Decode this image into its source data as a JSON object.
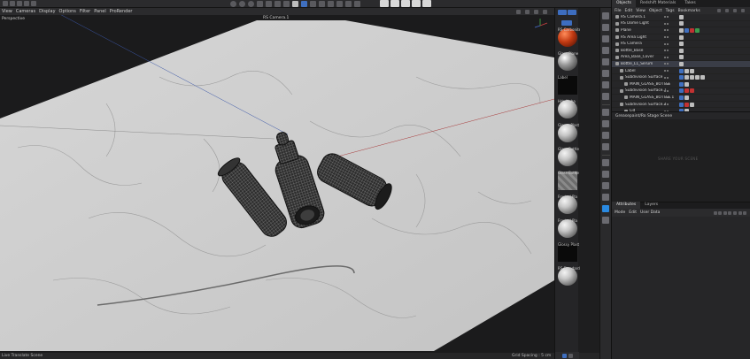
{
  "viewport": {
    "menu": [
      "View",
      "Cameras",
      "Display",
      "Options",
      "Filter",
      "Panel",
      "ProRender"
    ],
    "label": "Perspective",
    "camera": "RS Camera.1",
    "status_left": "Live Translate Scene",
    "status_right": "Grid Spacing : 5 cm"
  },
  "materials": {
    "header_label": "Mat Layer",
    "items": [
      {
        "label": "RS Carbonite",
        "style": "orange"
      },
      {
        "label": "Glass Plane",
        "style": "glass"
      },
      {
        "label": "Label",
        "style": "black"
      },
      {
        "label": "Hdr Alpha",
        "style": "sphere"
      },
      {
        "label": "Glossy Plast",
        "style": "sphere"
      },
      {
        "label": "Glass Bottle",
        "style": "sphere"
      },
      {
        "label": "Glass Bottle",
        "style": "checker"
      },
      {
        "label": "Frosted Pla",
        "style": "sphere"
      },
      {
        "label": "Frosted Pla",
        "style": "sphere"
      },
      {
        "label": "Glossy Plast",
        "style": "black"
      },
      {
        "label": "RS Standard",
        "style": "sphere"
      }
    ]
  },
  "panel": {
    "tabs": [
      "Objects",
      "Redshift Materials",
      "Takes"
    ],
    "menu": [
      "File",
      "Edit",
      "View",
      "Object",
      "Tags",
      "Bookmarks"
    ],
    "objects": [
      {
        "name": "RS Camera.1",
        "indent": 0
      },
      {
        "name": "RS Dome Light",
        "indent": 0
      },
      {
        "name": "Plane",
        "indent": 0
      },
      {
        "name": "RS Area Light",
        "indent": 0
      },
      {
        "name": "RS Camera",
        "indent": 0
      },
      {
        "name": "Bottle_Base",
        "indent": 0
      },
      {
        "name": "Area_Base_Cover",
        "indent": 0
      },
      {
        "name": "Bottle_L1_Serum",
        "indent": 0
      },
      {
        "name": "Label",
        "indent": 1
      },
      {
        "name": "Subdivision Surface",
        "indent": 1
      },
      {
        "name": "MAIN_GLASS_BOTTLE",
        "indent": 2
      },
      {
        "name": "Subdivision Surface.1",
        "indent": 1
      },
      {
        "name": "MAIN_GLASS_BOTTLE.1",
        "indent": 2
      },
      {
        "name": "Subdivision Surface.2",
        "indent": 1
      },
      {
        "name": "Lid",
        "indent": 2
      }
    ],
    "empty_title": "Greasepaint/Ro Stage Scene",
    "empty_watermark": "SHARE YOUR SCENE",
    "attr_tabs": [
      "Attributes",
      "Layers"
    ],
    "attr_menu": [
      "Mode",
      "Edit",
      "User Data"
    ]
  }
}
